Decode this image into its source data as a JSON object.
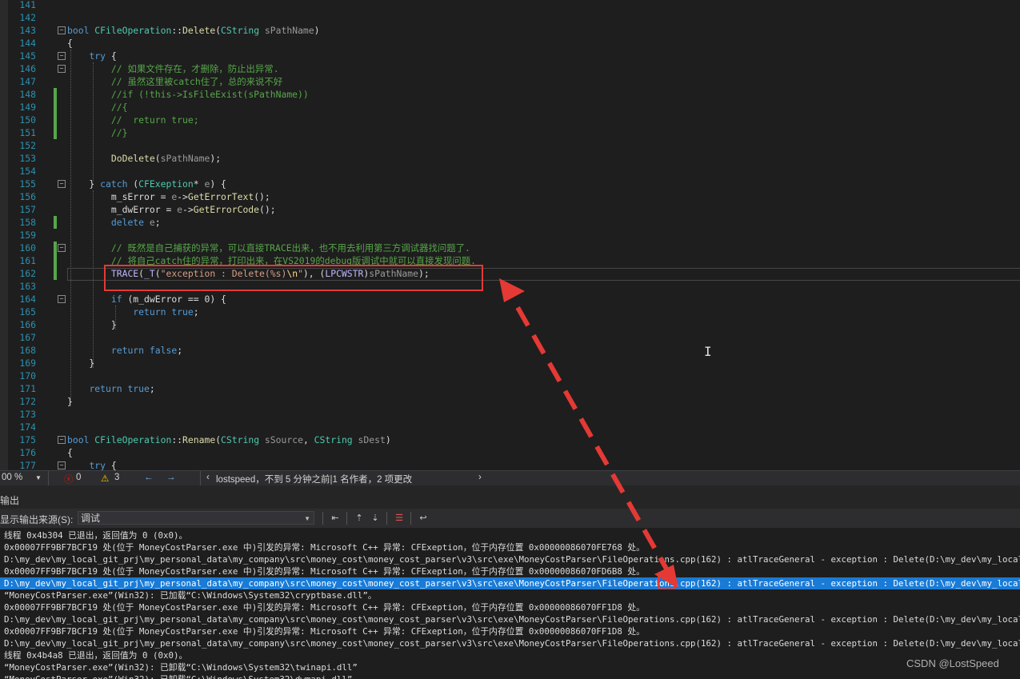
{
  "editor": {
    "lines": [
      {
        "n": "141",
        "html": ""
      },
      {
        "n": "142",
        "html": ""
      },
      {
        "n": "143",
        "html": "<span class='kw'>bool</span> <span class='tp'>CFileOperation</span>::<span class='fn'>Delete</span>(<span class='tp'>CString</span> <span class='pa'>sPathName</span>)"
      },
      {
        "n": "144",
        "html": "{"
      },
      {
        "n": "145",
        "html": "    <span class='kw'>try</span> {"
      },
      {
        "n": "146",
        "html": "        <span class='cm'>// 如果文件存在，才删除，防止出异常.</span>"
      },
      {
        "n": "147",
        "html": "        <span class='cm'>// 虽然这里被catch住了，总的来说不好</span>"
      },
      {
        "n": "148",
        "html": "        <span class='cm'>//if (!this->IsFileExist(sPathName))</span>"
      },
      {
        "n": "149",
        "html": "        <span class='cm'>//{</span>"
      },
      {
        "n": "150",
        "html": "        <span class='cm'>//  return true;</span>"
      },
      {
        "n": "151",
        "html": "        <span class='cm'>//}</span>"
      },
      {
        "n": "152",
        "html": ""
      },
      {
        "n": "153",
        "html": "        <span class='fn'>DoDelete</span>(<span class='pa'>sPathName</span>);"
      },
      {
        "n": "154",
        "html": ""
      },
      {
        "n": "155",
        "html": "    } <span class='kw'>catch</span> (<span class='tp'>CFExeption</span>* <span class='pa'>e</span>) {"
      },
      {
        "n": "156",
        "html": "        m_sError = <span class='pa'>e</span>-><span class='fn'>GetErrorText</span>();"
      },
      {
        "n": "157",
        "html": "        m_dwError = <span class='pa'>e</span>-><span class='fn'>GetErrorCode</span>();"
      },
      {
        "n": "158",
        "html": "        <span class='kw'>delete</span> <span class='pa'>e</span>;"
      },
      {
        "n": "159",
        "html": ""
      },
      {
        "n": "160",
        "html": "        <span class='cm'>// 既然是自己捕获的异常，可以直接TRACE出来，也不用去利用第三方调试器找问题了.</span>"
      },
      {
        "n": "161",
        "html": "        <span class='cm'>// 将自己catch住的异常，打印出来，在VS2019的debug版调试中就可以直接发现问题.</span>"
      },
      {
        "n": "162",
        "html": "        <span class='mac'>TRACE</span>(<span class='mac'>_T</span>(<span class='st'>\"exception : Delete(%s)</span><span class='esc'>\\n</span><span class='st'>\"</span>), (<span class='mac'>LPCWSTR</span>)<span class='pa'>sPathName</span>);"
      },
      {
        "n": "163",
        "html": ""
      },
      {
        "n": "164",
        "html": "        <span class='kw'>if</span> (m_dwError == 0) {"
      },
      {
        "n": "165",
        "html": "            <span class='kw'>return</span> <span class='kw'>true</span>;"
      },
      {
        "n": "166",
        "html": "        }"
      },
      {
        "n": "167",
        "html": ""
      },
      {
        "n": "168",
        "html": "        <span class='kw'>return</span> <span class='kw'>false</span>;"
      },
      {
        "n": "169",
        "html": "    }"
      },
      {
        "n": "170",
        "html": ""
      },
      {
        "n": "171",
        "html": "    <span class='kw'>return</span> <span class='kw'>true</span>;"
      },
      {
        "n": "172",
        "html": "}"
      },
      {
        "n": "173",
        "html": ""
      },
      {
        "n": "174",
        "html": ""
      },
      {
        "n": "175",
        "html": "<span class='kw'>bool</span> <span class='tp'>CFileOperation</span>::<span class='fn'>Rename</span>(<span class='tp'>CString</span> <span class='pa'>sSource</span>, <span class='tp'>CString</span> <span class='pa'>sDest</span>)"
      },
      {
        "n": "176",
        "html": "{"
      },
      {
        "n": "177",
        "html": "    <span class='kw'>try</span> {"
      }
    ]
  },
  "status": {
    "zoom": "00 %",
    "errors": "0",
    "warnings": "3",
    "git_info": "lostspeed，不到 5 分钟之前|1 名作者，2 项更改"
  },
  "output_panel": {
    "title": "输出",
    "source_label": "显示输出来源(S):",
    "source_value": "调试",
    "lines": [
      "线程 0x4b304 已退出，返回值为 0 (0x0)。",
      "0x00007FF9BF7BCF19 处(位于 MoneyCostParser.exe 中)引发的异常: Microsoft C++ 异常: CFExeption，位于内存位置 0x00000086070FE768 处。",
      "D:\\my_dev\\my_local_git_prj\\my_personal_data\\my_company\\src\\money_cost\\money_cost_parser\\v3\\src\\exe\\MoneyCostParser\\FileOperations.cpp(162) : atlTraceGeneral - exception : Delete(D:\\my_dev\\my_local_git_prj\\my_pers",
      "0x00007FF9BF7BCF19 处(位于 MoneyCostParser.exe 中)引发的异常: Microsoft C++ 异常: CFExeption，位于内存位置 0x00000086070FD6B8 处。",
      "D:\\my_dev\\my_local_git_prj\\my_personal_data\\my_company\\src\\money_cost\\money_cost_parser\\v3\\src\\exe\\MoneyCostParser\\FileOperations.cpp(162) : atlTraceGeneral - exception : Delete(D:\\my_dev\\my_local_git_prj\\my_pers",
      "“MoneyCostParser.exe”(Win32): 已加载“C:\\Windows\\System32\\cryptbase.dll”。",
      "0x00007FF9BF7BCF19 处(位于 MoneyCostParser.exe 中)引发的异常: Microsoft C++ 异常: CFExeption，位于内存位置 0x00000086070FF1D8 处。",
      "D:\\my_dev\\my_local_git_prj\\my_personal_data\\my_company\\src\\money_cost\\money_cost_parser\\v3\\src\\exe\\MoneyCostParser\\FileOperations.cpp(162) : atlTraceGeneral - exception : Delete(D:\\my_dev\\my_local_git_prj\\my_pers",
      "0x00007FF9BF7BCF19 处(位于 MoneyCostParser.exe 中)引发的异常: Microsoft C++ 异常: CFExeption，位于内存位置 0x00000086070FF1D8 处。",
      "D:\\my_dev\\my_local_git_prj\\my_personal_data\\my_company\\src\\money_cost\\money_cost_parser\\v3\\src\\exe\\MoneyCostParser\\FileOperations.cpp(162) : atlTraceGeneral - exception : Delete(D:\\my_dev\\my_local_git_prj\\my_pers",
      "线程 0x4b4a8 已退出，返回值为 0 (0x0)。",
      "“MoneyCostParser.exe”(Win32): 已卸载“C:\\Windows\\System32\\twinapi.dll”",
      "“MoneyCostParser.exe”(Win32): 已卸载“C:\\Windows\\System32\\dwmapi.dll”"
    ],
    "selected_index": 4
  },
  "watermark": "CSDN @LostSpeed",
  "colors": {
    "annotation": "#e53935",
    "selection": "#1a7bd6",
    "background": "#1e1e1e"
  }
}
